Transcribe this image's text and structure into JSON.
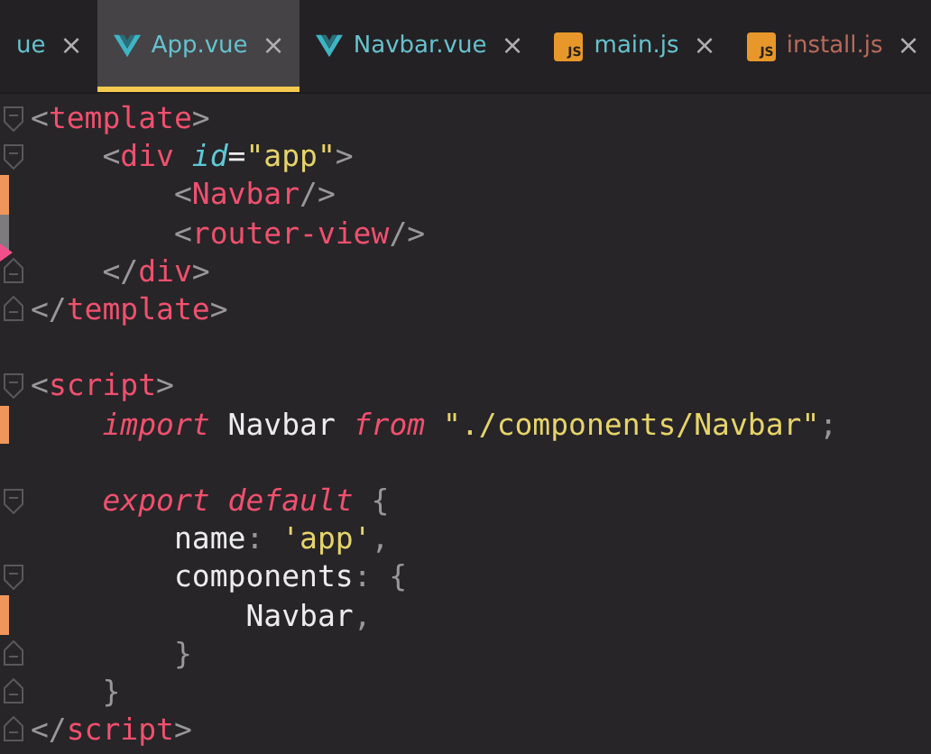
{
  "tabs": [
    {
      "label": "ue",
      "kind": "file",
      "selected": false,
      "color": "#66c2cd"
    },
    {
      "label": "App.vue",
      "kind": "vue_file",
      "selected": true,
      "color": "#66c2cd"
    },
    {
      "label": "Navbar.vue",
      "kind": "vue_file",
      "selected": false,
      "color": "#66c2cd"
    },
    {
      "label": "main.js",
      "kind": "script_file",
      "badge": "JS",
      "selected": false,
      "color": "#66c2cd"
    },
    {
      "label": "install.js",
      "kind": "script_file",
      "badge": "JS",
      "selected": false,
      "color": "#b86a5a"
    }
  ],
  "close_glyph": "×",
  "editor": {
    "lines": [
      {
        "kind": "code",
        "fold_start": true,
        "fold_end": false,
        "modified": false,
        "changed": false,
        "deleted": false,
        "tokens": [
          {
            "text": "<",
            "kind": "punct"
          },
          {
            "text": "template",
            "kind": "tag"
          },
          {
            "text": ">",
            "kind": "punct"
          }
        ]
      },
      {
        "kind": "code",
        "fold_start": true,
        "fold_end": false,
        "modified": false,
        "changed": false,
        "deleted": false,
        "tokens": [
          {
            "text": "    <",
            "kind": "punct"
          },
          {
            "text": "div",
            "kind": "tag"
          },
          {
            "text": " id",
            "kind": "attr"
          },
          {
            "text": "=",
            "kind": "plain"
          },
          {
            "text": "\"app\"",
            "kind": "string"
          },
          {
            "text": ">",
            "kind": "punct"
          }
        ]
      },
      {
        "kind": "code",
        "fold_start": false,
        "fold_end": false,
        "modified": true,
        "changed": false,
        "deleted": false,
        "tokens": [
          {
            "text": "        <",
            "kind": "punct"
          },
          {
            "text": "Navbar",
            "kind": "tag"
          },
          {
            "text": "/>",
            "kind": "punct"
          }
        ]
      },
      {
        "kind": "code",
        "fold_start": false,
        "fold_end": false,
        "modified": false,
        "changed": true,
        "deleted": false,
        "tokens": [
          {
            "text": "        <",
            "kind": "punct"
          },
          {
            "text": "router-view",
            "kind": "tag"
          },
          {
            "text": "/>",
            "kind": "punct"
          }
        ]
      },
      {
        "kind": "code",
        "fold_start": false,
        "fold_end": true,
        "modified": false,
        "changed": false,
        "deleted": true,
        "tokens": [
          {
            "text": "    </",
            "kind": "punct"
          },
          {
            "text": "div",
            "kind": "tag"
          },
          {
            "text": ">",
            "kind": "punct"
          }
        ]
      },
      {
        "kind": "code",
        "fold_start": false,
        "fold_end": true,
        "modified": false,
        "changed": false,
        "deleted": false,
        "tokens": [
          {
            "text": "</",
            "kind": "punct"
          },
          {
            "text": "template",
            "kind": "tag"
          },
          {
            "text": ">",
            "kind": "punct"
          }
        ]
      },
      {
        "kind": "blank",
        "fold_start": false,
        "fold_end": false,
        "modified": false,
        "changed": false,
        "deleted": false
      },
      {
        "kind": "code",
        "fold_start": true,
        "fold_end": false,
        "modified": false,
        "changed": false,
        "deleted": false,
        "tokens": [
          {
            "text": "<",
            "kind": "punct"
          },
          {
            "text": "script",
            "kind": "tag"
          },
          {
            "text": ">",
            "kind": "punct"
          }
        ]
      },
      {
        "kind": "code",
        "fold_start": false,
        "fold_end": false,
        "modified": true,
        "changed": false,
        "deleted": false,
        "tokens": [
          {
            "text": "    import",
            "kind": "keyword"
          },
          {
            "text": " Navbar ",
            "kind": "plain"
          },
          {
            "text": "from",
            "kind": "keyword"
          },
          {
            "text": " \"./components/Navbar\"",
            "kind": "string"
          },
          {
            "text": ";",
            "kind": "punct"
          }
        ]
      },
      {
        "kind": "blank",
        "fold_start": false,
        "fold_end": false,
        "modified": false,
        "changed": false,
        "deleted": false
      },
      {
        "kind": "code",
        "fold_start": true,
        "fold_end": false,
        "modified": false,
        "changed": false,
        "deleted": false,
        "tokens": [
          {
            "text": "    export default",
            "kind": "keyword"
          },
          {
            "text": " {",
            "kind": "punct"
          }
        ]
      },
      {
        "kind": "code",
        "fold_start": false,
        "fold_end": false,
        "modified": false,
        "changed": false,
        "deleted": false,
        "tokens": [
          {
            "text": "        name",
            "kind": "plain"
          },
          {
            "text": ": ",
            "kind": "punct"
          },
          {
            "text": "'app'",
            "kind": "string"
          },
          {
            "text": ",",
            "kind": "punct"
          }
        ]
      },
      {
        "kind": "code",
        "fold_start": true,
        "fold_end": false,
        "modified": false,
        "changed": false,
        "deleted": false,
        "tokens": [
          {
            "text": "        components",
            "kind": "plain"
          },
          {
            "text": ": {",
            "kind": "punct"
          }
        ]
      },
      {
        "kind": "code",
        "fold_start": false,
        "fold_end": false,
        "modified": true,
        "changed": false,
        "deleted": false,
        "tokens": [
          {
            "text": "            Navbar",
            "kind": "plain"
          },
          {
            "text": ",",
            "kind": "punct"
          }
        ]
      },
      {
        "kind": "code",
        "fold_start": false,
        "fold_end": true,
        "modified": false,
        "changed": false,
        "deleted": false,
        "tokens": [
          {
            "text": "        }",
            "kind": "punct"
          }
        ]
      },
      {
        "kind": "code",
        "fold_start": false,
        "fold_end": true,
        "modified": false,
        "changed": false,
        "deleted": false,
        "tokens": [
          {
            "text": "    }",
            "kind": "punct"
          }
        ]
      },
      {
        "kind": "code",
        "fold_start": false,
        "fold_end": true,
        "modified": false,
        "changed": false,
        "deleted": false,
        "tokens": [
          {
            "text": "</",
            "kind": "punct"
          },
          {
            "text": "script",
            "kind": "tag"
          },
          {
            "text": ">",
            "kind": "punct"
          }
        ]
      }
    ]
  }
}
